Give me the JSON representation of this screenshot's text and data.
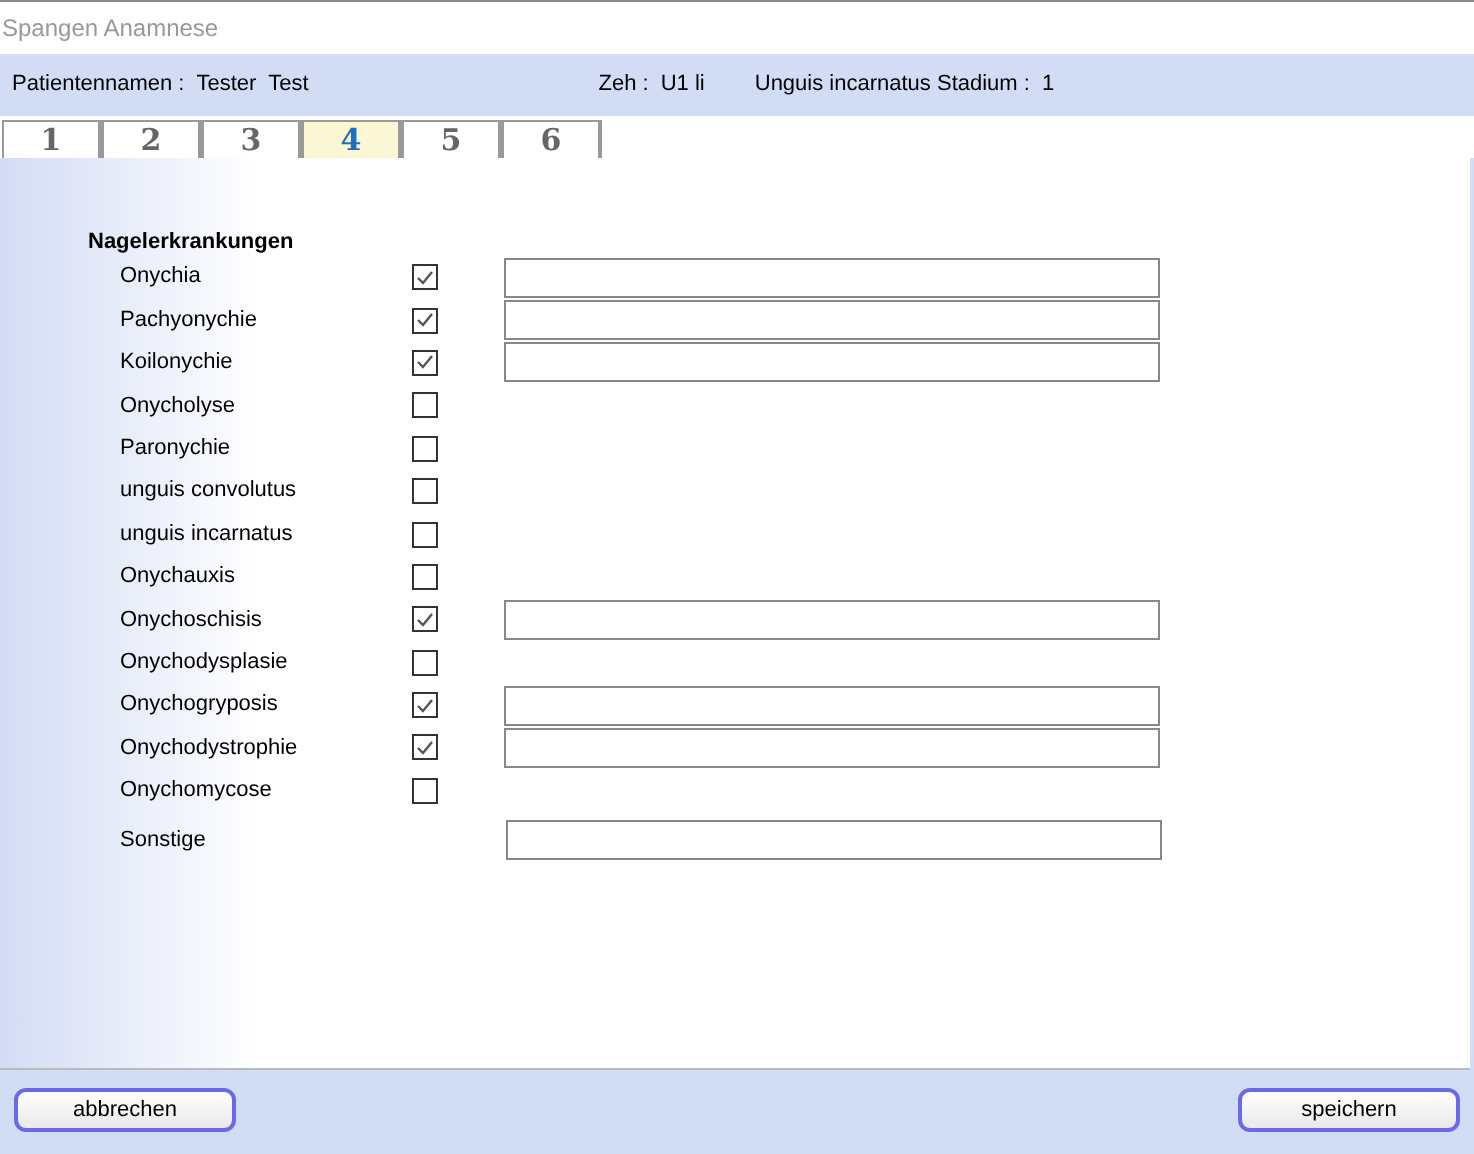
{
  "window": {
    "title": "Spangen Anamnese"
  },
  "header": [
    {
      "label": "Patientennamen :",
      "value": "Tester  Test"
    },
    {
      "label": "Zeh :",
      "value": "U1 li"
    },
    {
      "label": "Unguis incarnatus Stadium  :",
      "value": "1"
    }
  ],
  "tabs": [
    {
      "label": "1",
      "selected": false
    },
    {
      "label": "2",
      "selected": false
    },
    {
      "label": "3",
      "selected": false
    },
    {
      "label": "4",
      "selected": true
    },
    {
      "label": "5",
      "selected": false
    },
    {
      "label": "6",
      "selected": false
    }
  ],
  "section_title": "Nagelerkrankungen",
  "items": [
    {
      "kind": "check",
      "label": "Onychia",
      "checked": true
    },
    {
      "kind": "check",
      "label": "Pachyonychie",
      "checked": true
    },
    {
      "kind": "check",
      "label": "Koilonychie",
      "checked": true
    },
    {
      "kind": "check",
      "label": "Onycholyse",
      "checked": false
    },
    {
      "kind": "check",
      "label": "Paronychie",
      "checked": false
    },
    {
      "kind": "check",
      "label": "unguis convolutus",
      "checked": false
    },
    {
      "kind": "check",
      "label": "unguis incarnatus",
      "checked": false
    },
    {
      "kind": "check",
      "label": "Onychauxis",
      "checked": false
    },
    {
      "kind": "check",
      "label": "Onychoschisis",
      "checked": true
    },
    {
      "kind": "check",
      "label": "Onychodysplasie",
      "checked": false
    },
    {
      "kind": "check",
      "label": "Onychogryposis",
      "checked": true
    },
    {
      "kind": "check",
      "label": "Onychodystrophie",
      "checked": true
    },
    {
      "kind": "check",
      "label": "Onychomycose",
      "checked": false
    },
    {
      "kind": "field",
      "label": "Sonstige"
    }
  ],
  "buttons": [
    "abbrechen",
    "speichern"
  ]
}
